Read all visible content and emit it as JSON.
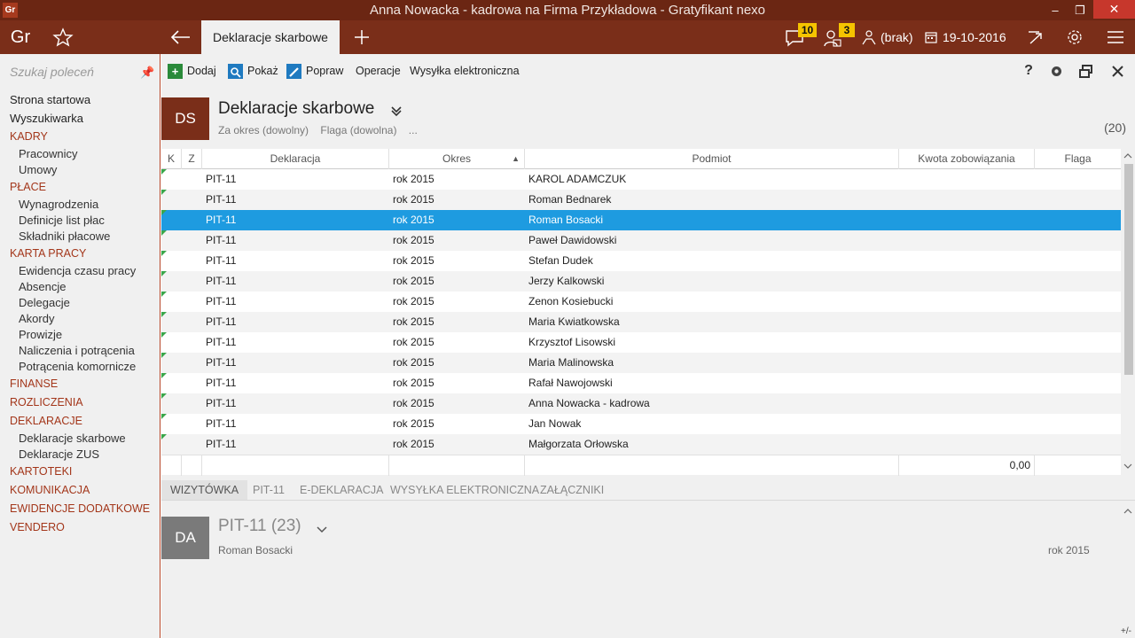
{
  "window": {
    "title": "Anna Nowacka - kadrowa na Firma Przykładowa - Gratyfikant nexo",
    "app_icon": "Gr",
    "minimize": "–",
    "restore": "❐",
    "close": "✕"
  },
  "topbar": {
    "logo": "Gr",
    "active_tab": "Deklaracje skarbowe",
    "messages_count": "10",
    "users_count": "3",
    "user_status": "(brak)",
    "date": "19-10-2016"
  },
  "sidebar": {
    "search_placeholder": "Szukaj poleceń",
    "items": [
      {
        "label": "Strona startowa",
        "type": "top"
      },
      {
        "label": "Wyszukiwarka",
        "type": "top"
      },
      {
        "label": "KADRY",
        "type": "sec"
      },
      {
        "label": "Pracownicy",
        "type": "sub"
      },
      {
        "label": "Umowy",
        "type": "sub"
      },
      {
        "label": "PŁACE",
        "type": "sec"
      },
      {
        "label": "Wynagrodzenia",
        "type": "sub"
      },
      {
        "label": "Definicje list płac",
        "type": "sub"
      },
      {
        "label": "Składniki płacowe",
        "type": "sub"
      },
      {
        "label": "KARTA PRACY",
        "type": "sec"
      },
      {
        "label": "Ewidencja czasu pracy",
        "type": "sub"
      },
      {
        "label": "Absencje",
        "type": "sub"
      },
      {
        "label": "Delegacje",
        "type": "sub"
      },
      {
        "label": "Akordy",
        "type": "sub"
      },
      {
        "label": "Prowizje",
        "type": "sub"
      },
      {
        "label": "Naliczenia i potrącenia",
        "type": "sub"
      },
      {
        "label": "Potrącenia komornicze",
        "type": "sub"
      },
      {
        "label": "FINANSE",
        "type": "sec"
      },
      {
        "label": "ROZLICZENIA",
        "type": "sec"
      },
      {
        "label": "DEKLARACJE",
        "type": "sec"
      },
      {
        "label": "Deklaracje skarbowe",
        "type": "sub"
      },
      {
        "label": "Deklaracje ZUS",
        "type": "sub"
      },
      {
        "label": "KARTOTEKI",
        "type": "sec"
      },
      {
        "label": "KOMUNIKACJA",
        "type": "sec"
      },
      {
        "label": "EWIDENCJE DODATKOWE",
        "type": "sec"
      },
      {
        "label": "VENDERO",
        "type": "sec"
      }
    ]
  },
  "toolbar": {
    "add": "Dodaj",
    "show": "Pokaż",
    "edit": "Popraw",
    "operations": "Operacje",
    "send": "Wysyłka elektroniczna",
    "help": "?"
  },
  "header": {
    "badge": "DS",
    "title": "Deklaracje skarbowe",
    "filter_period": "Za okres (dowolny)",
    "filter_flag": "Flaga (dowolna)",
    "filter_more": "...",
    "count": "(20)"
  },
  "grid": {
    "columns": {
      "k": "K",
      "z": "Z",
      "declaration": "Deklaracja",
      "period": "Okres",
      "subject": "Podmiot",
      "amount": "Kwota zobowiązania",
      "flag": "Flaga"
    },
    "rows": [
      {
        "declaration": "PIT-11",
        "period": "rok 2015",
        "subject": "KAROL ADAMCZUK"
      },
      {
        "declaration": "PIT-11",
        "period": "rok 2015",
        "subject": "Roman Bednarek"
      },
      {
        "declaration": "PIT-11",
        "period": "rok 2015",
        "subject": "Roman Bosacki"
      },
      {
        "declaration": "PIT-11",
        "period": "rok 2015",
        "subject": "Paweł Dawidowski"
      },
      {
        "declaration": "PIT-11",
        "period": "rok 2015",
        "subject": "Stefan Dudek"
      },
      {
        "declaration": "PIT-11",
        "period": "rok 2015",
        "subject": "Jerzy Kalkowski"
      },
      {
        "declaration": "PIT-11",
        "period": "rok 2015",
        "subject": "Zenon Kosiebucki"
      },
      {
        "declaration": "PIT-11",
        "period": "rok 2015",
        "subject": "Maria Kwiatkowska"
      },
      {
        "declaration": "PIT-11",
        "period": "rok 2015",
        "subject": "Krzysztof Lisowski"
      },
      {
        "declaration": "PIT-11",
        "period": "rok 2015",
        "subject": "Maria Malinowska"
      },
      {
        "declaration": "PIT-11",
        "period": "rok 2015",
        "subject": "Rafał Nawojowski"
      },
      {
        "declaration": "PIT-11",
        "period": "rok 2015",
        "subject": "Anna Nowacka - kadrowa"
      },
      {
        "declaration": "PIT-11",
        "period": "rok 2015",
        "subject": "Jan Nowak"
      },
      {
        "declaration": "PIT-11",
        "period": "rok 2015",
        "subject": "Małgorzata Orłowska"
      }
    ],
    "selected_index": 2,
    "total_amount": "0,00"
  },
  "bottom_tabs": [
    "WIZYTÓWKA",
    "PIT-11",
    "E-DEKLARACJA",
    "WYSYŁKA ELEKTRONICZNA",
    "ZAŁĄCZNIKI"
  ],
  "detail": {
    "badge": "DA",
    "title": "PIT-11 (23)",
    "subject": "Roman Bosacki",
    "period": "rok 2015",
    "plus_minus": "+/-"
  },
  "colors": {
    "brand_dark": "#6b2613",
    "brand": "#7a2e19",
    "accent_red": "#a3361a",
    "selection": "#1e9be0",
    "badge_yellow": "#f5c400",
    "add_green": "#2a8a3a",
    "search_blue": "#1f7ac0"
  }
}
